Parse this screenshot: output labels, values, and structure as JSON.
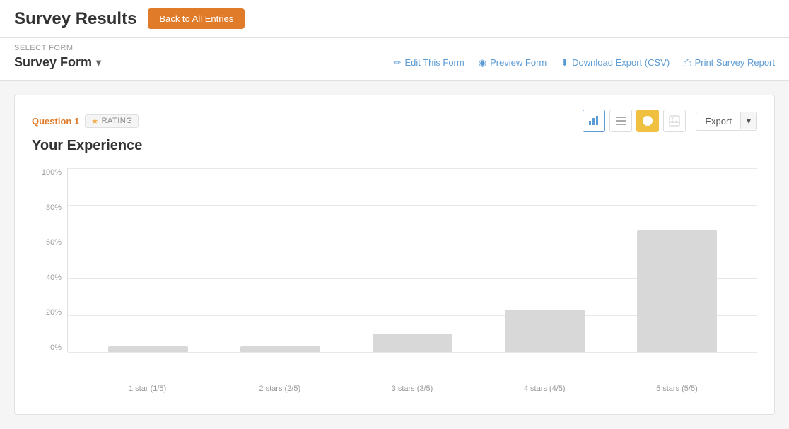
{
  "header": {
    "title": "Survey Results",
    "back_button_label": "Back to All Entries"
  },
  "sub_header": {
    "select_form_label": "SELECT FORM",
    "form_name": "Survey Form",
    "actions": [
      {
        "id": "edit-form",
        "label": "Edit This Form",
        "icon": "✏️"
      },
      {
        "id": "preview-form",
        "label": "Preview Form",
        "icon": "👁"
      },
      {
        "id": "download-export",
        "label": "Download Export (CSV)",
        "icon": "⬇"
      },
      {
        "id": "print-survey",
        "label": "Print Survey Report",
        "icon": "🖨"
      }
    ]
  },
  "question_card": {
    "question_number": "Question 1",
    "question_type": "RATING",
    "question_title": "Your Experience",
    "export_label": "Export",
    "chart_types": [
      {
        "id": "bar",
        "label": "Bar Chart",
        "active": true
      },
      {
        "id": "list",
        "label": "List View",
        "active": false
      },
      {
        "id": "pie",
        "label": "Pie Chart",
        "active": true,
        "hovered": true
      },
      {
        "id": "image",
        "label": "Image View",
        "active": false
      }
    ],
    "chart": {
      "y_labels": [
        "100%",
        "80%",
        "60%",
        "40%",
        "20%",
        "0%"
      ],
      "bars": [
        {
          "label": "1 star (1/5)",
          "value": 2,
          "height_pct": 3
        },
        {
          "label": "2 stars (2/5)",
          "value": 2,
          "height_pct": 3
        },
        {
          "label": "3 stars (3/5)",
          "value": 8,
          "height_pct": 10
        },
        {
          "label": "4 stars (4/5)",
          "value": 22,
          "height_pct": 23
        },
        {
          "label": "5 stars (5/5)",
          "value": 65,
          "height_pct": 66
        }
      ]
    }
  }
}
